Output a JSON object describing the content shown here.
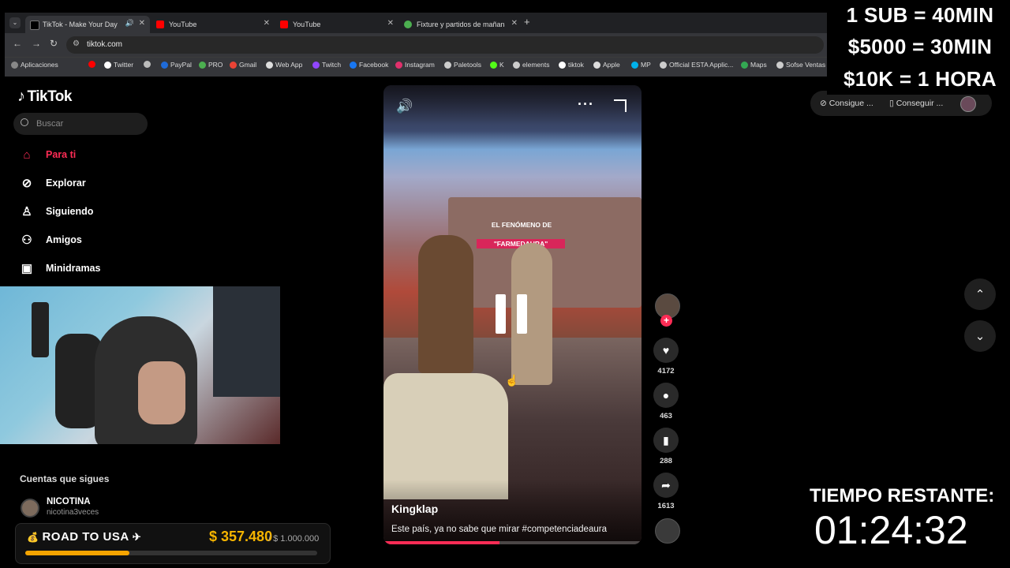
{
  "browser": {
    "tabs": [
      {
        "title": "TikTok - Make Your Day",
        "fav_color": "#000000",
        "active": true
      },
      {
        "title": "YouTube",
        "fav_color": "#ff0000"
      },
      {
        "title": "YouTube",
        "fav_color": "#ff0000"
      },
      {
        "title": "Fixture y partidos de mañana e",
        "fav_color": "#4caf50"
      }
    ],
    "url": "tiktok.com",
    "bookmarks": [
      {
        "label": "Aplicaciones",
        "color": "#888888"
      },
      {
        "label": "",
        "color": "#ff0000"
      },
      {
        "label": "Twitter",
        "color": "#ffffff"
      },
      {
        "label": "",
        "color": "#bbbbbb"
      },
      {
        "label": "PayPal",
        "color": "#1f6bd8"
      },
      {
        "label": "PRO",
        "color": "#4caf50"
      },
      {
        "label": "Gmail",
        "color": "#ea4335"
      },
      {
        "label": "Web App",
        "color": "#dddddd"
      },
      {
        "label": "Twitch",
        "color": "#9146ff"
      },
      {
        "label": "Facebook",
        "color": "#1877f2"
      },
      {
        "label": "Instagram",
        "color": "#e1306c"
      },
      {
        "label": "Paletools",
        "color": "#cccccc"
      },
      {
        "label": "K",
        "color": "#53fc18"
      },
      {
        "label": "elements",
        "color": "#cccccc"
      },
      {
        "label": "tiktok",
        "color": "#ffffff"
      },
      {
        "label": "Apple",
        "color": "#dddddd"
      },
      {
        "label": "MP",
        "color": "#00b1ea"
      },
      {
        "label": "Official ESTA Applic...",
        "color": "#cccccc"
      },
      {
        "label": "Maps",
        "color": "#34a853"
      },
      {
        "label": "Sofse Ventas",
        "color": "#cccccc"
      }
    ]
  },
  "tiktok": {
    "logo": "TikTok",
    "search_placeholder": "Buscar",
    "nav": [
      {
        "label": "Para ti",
        "icon": "home-icon"
      },
      {
        "label": "Explorar",
        "icon": "compass-icon"
      },
      {
        "label": "Siguiendo",
        "icon": "user-plus-icon"
      },
      {
        "label": "Amigos",
        "icon": "friends-icon"
      },
      {
        "label": "Minidramas",
        "icon": "film-icon"
      }
    ],
    "following_title": "Cuentas que sigues",
    "following": [
      {
        "name": "NICOTINA",
        "handle": "nicotina3veces"
      }
    ],
    "video": {
      "screen_title": "EL FENÓMENO DE",
      "screen_subtitle": "\"FARMEDAURA\"",
      "author": "Kingklap",
      "caption": "Este país, ya no sabe que mirar #competenciadeaura",
      "progress_fraction": 0.45
    },
    "actions": {
      "likes": "4172",
      "comments": "463",
      "saves": "288",
      "shares": "1613"
    },
    "get_buttons": [
      "Consigue ...",
      "Conseguir ..."
    ]
  },
  "overlay": {
    "lines": [
      "1 SUB = 40MIN",
      "$5000 = 30MIN",
      "$10K = 1 HORA"
    ],
    "timer_label": "TIEMPO RESTANTE:",
    "timer_value": "01:24:32"
  },
  "goal": {
    "title": "ROAD TO USA",
    "amount": "$ 357.480",
    "total": "/ $ 1.000.000",
    "progress_fraction": 0.357,
    "accent": "#f5a400"
  }
}
